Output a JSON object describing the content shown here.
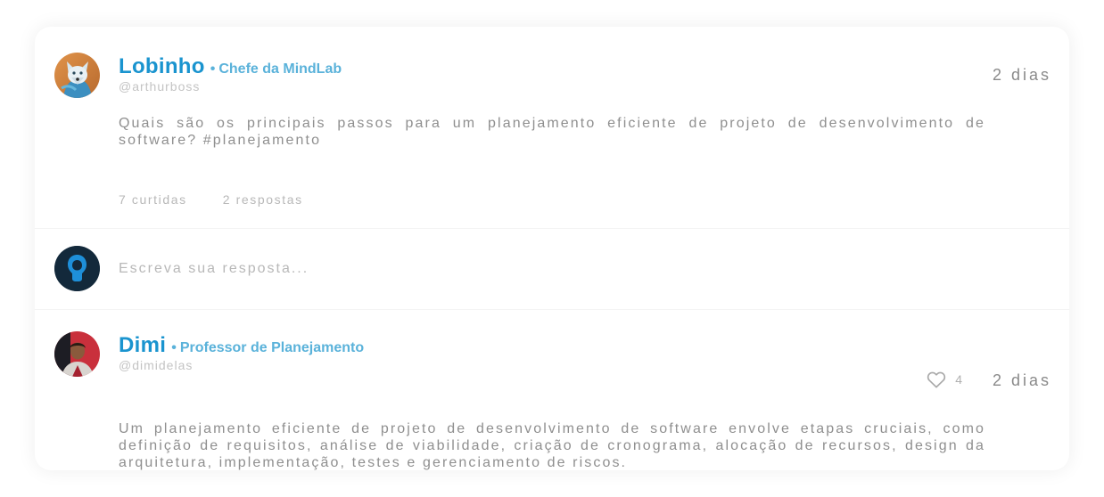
{
  "post": {
    "author_name": "Lobinho",
    "separator": "•",
    "author_role": "Chefe da MindLab",
    "author_handle": "@arthurboss",
    "time": "2 dias",
    "text": "Quais são os principais passos para um planejamento eficiente de projeto de desenvolvimento de software? #planejamento",
    "likes": "7 curtidas",
    "replies": "2 respostas"
  },
  "reply_box": {
    "placeholder": "Escreva sua resposta..."
  },
  "answer": {
    "author_name": "Dimi",
    "separator": "•",
    "author_role": "Professor de Planejamento",
    "author_handle": "@dimidelas",
    "like_count": "4",
    "time": "2 dias",
    "text": "Um planejamento eficiente de projeto de desenvolvimento de software envolve etapas cruciais, como definição de requisitos, análise de viabilidade, criação de cronograma, alocação de recursos, design da arquitetura, implementação, testes e gerenciamento de riscos."
  },
  "colors": {
    "accent": "#1a94cf",
    "role": "#5ab2da",
    "text": "#8f8f8f",
    "muted": "#b8b8b8"
  },
  "icons": {
    "post_avatar": "wolf-avatar",
    "reply_avatar": "user-silhouette-avatar",
    "answer_avatar": "person-photo-avatar",
    "like": "heart-icon"
  }
}
